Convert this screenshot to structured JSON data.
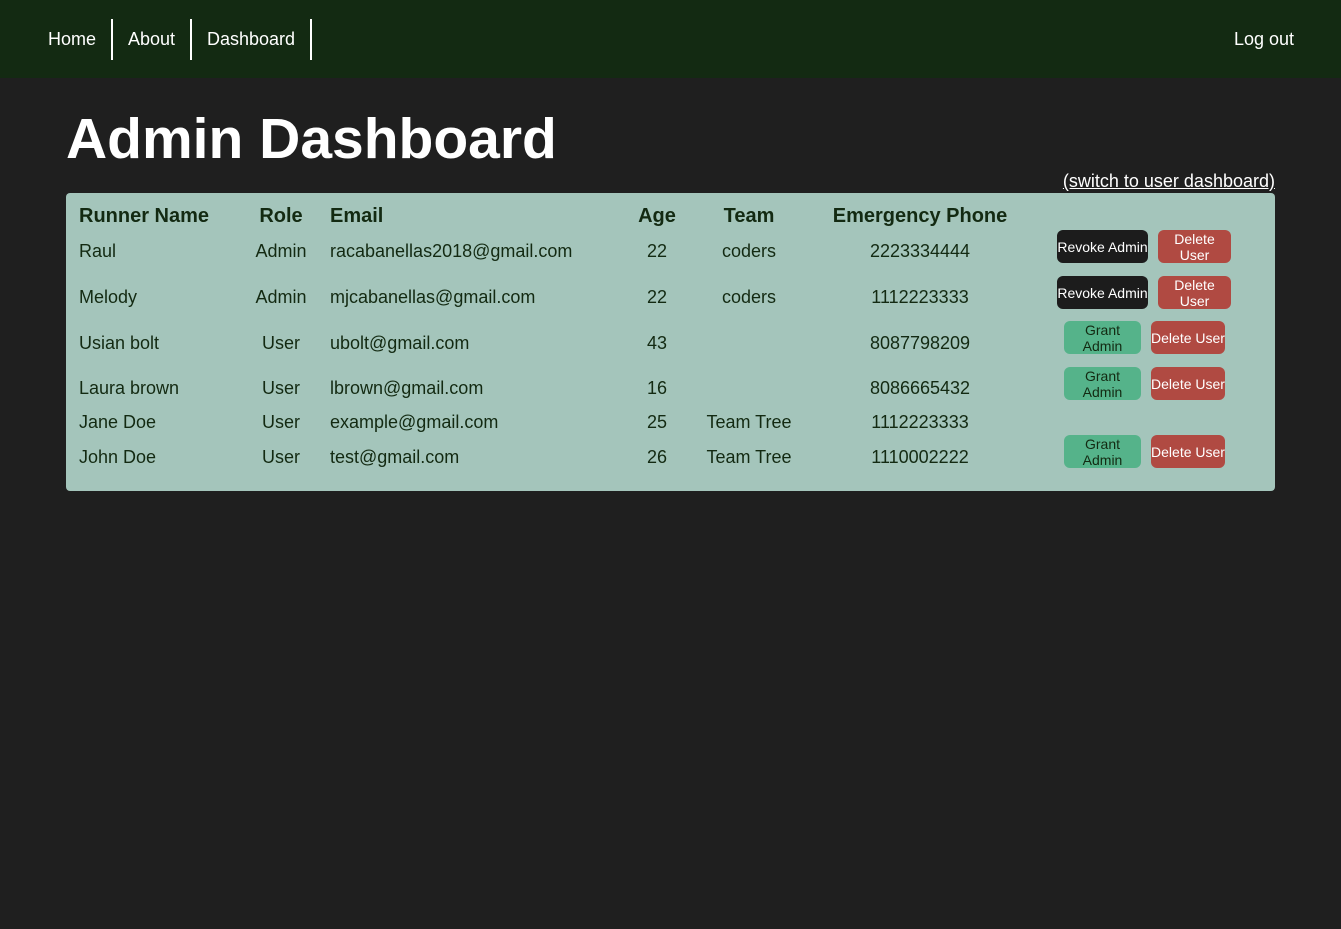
{
  "nav": {
    "home": "Home",
    "about": "About",
    "dashboard": "Dashboard",
    "logout": "Log out"
  },
  "page": {
    "title": "Admin Dashboard",
    "switch_link": "(switch to user dashboard)"
  },
  "colors": {
    "navbar": "#132a12",
    "background": "#1f1f1f",
    "panel": "#a4c5bb",
    "revoke_button": "#1c1c1c",
    "grant_button": "#55b38a",
    "delete_button": "#b04a42"
  },
  "table": {
    "headers": {
      "name": "Runner Name",
      "role": "Role",
      "email": "Email",
      "age": "Age",
      "team": "Team",
      "phone": "Emergency Phone"
    },
    "rows": [
      {
        "name": "Raul",
        "role": "Admin",
        "email": "racabanellas2018@gmail.com",
        "age": "22",
        "team": "coders",
        "phone": "2223334444",
        "admin_action": "Revoke Admin",
        "delete_action": "Delete User"
      },
      {
        "name": "Melody",
        "role": "Admin",
        "email": "mjcabanellas@gmail.com",
        "age": "22",
        "team": "coders",
        "phone": "1112223333",
        "admin_action": "Revoke Admin",
        "delete_action": "Delete User"
      },
      {
        "name": "Usian bolt",
        "role": "User",
        "email": "ubolt@gmail.com",
        "age": "43",
        "team": "",
        "phone": "8087798209",
        "admin_action": "Grant Admin",
        "delete_action": "Delete User"
      },
      {
        "name": "Laura brown",
        "role": "User",
        "email": "lbrown@gmail.com",
        "age": "16",
        "team": "",
        "phone": "8086665432",
        "admin_action": "Grant Admin",
        "delete_action": "Delete User"
      },
      {
        "name": "Jane Doe",
        "role": "User",
        "email": "example@gmail.com",
        "age": "25",
        "team": "Team Tree",
        "phone": "1112223333",
        "admin_action": "",
        "delete_action": ""
      },
      {
        "name": "John Doe",
        "role": "User",
        "email": "test@gmail.com",
        "age": "26",
        "team": "Team Tree",
        "phone": "1110002222",
        "admin_action": "Grant Admin",
        "delete_action": "Delete User"
      }
    ]
  }
}
